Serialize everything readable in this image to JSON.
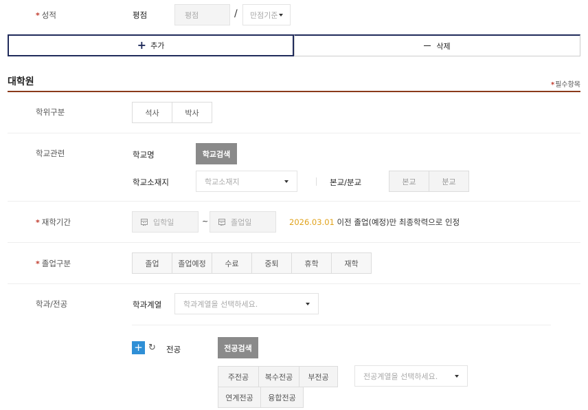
{
  "grade": {
    "label": "성적",
    "gpa_label": "평점",
    "gpa_placeholder": "평점",
    "slash": "/",
    "scale_placeholder": "만점기준"
  },
  "actions": {
    "add_label": "추가",
    "delete_label": "삭제"
  },
  "section": {
    "title": "대학원",
    "required_note": "필수항목"
  },
  "degree": {
    "label": "학위구분",
    "options": [
      "석사",
      "박사"
    ]
  },
  "school": {
    "label": "학교관련",
    "name_label": "학교명",
    "search_button": "학교검색",
    "location_label": "학교소재지",
    "location_placeholder": "학교소재지",
    "campus_label": "본교/분교",
    "campus_options": [
      "본교",
      "분교"
    ]
  },
  "period": {
    "label": "재학기간",
    "start_placeholder": "입학일",
    "tilde": "~",
    "end_placeholder": "졸업일",
    "note_date": "2026.03.01",
    "note_text": "이전 졸업(예정)만 최종학력으로 인정"
  },
  "graduation": {
    "label": "졸업구분",
    "options": [
      "졸업",
      "졸업예정",
      "수료",
      "중퇴",
      "휴학",
      "재학"
    ]
  },
  "major": {
    "label": "학과/전공",
    "category_label": "학과계열",
    "category_placeholder": "학과계열을 선택하세요.",
    "major_label": "전공",
    "search_button": "전공검색",
    "type_options": [
      "주전공",
      "복수전공",
      "부전공",
      "연계전공",
      "융합전공"
    ],
    "major_category_placeholder": "전공계열을 선택하세요."
  },
  "colors": {
    "accent_navy": "#1f2a5a",
    "required_red": "#c0392b",
    "date_orange": "#e0a21b",
    "plus_blue": "#2f8fd6",
    "section_rule": "#8a3a1a"
  }
}
